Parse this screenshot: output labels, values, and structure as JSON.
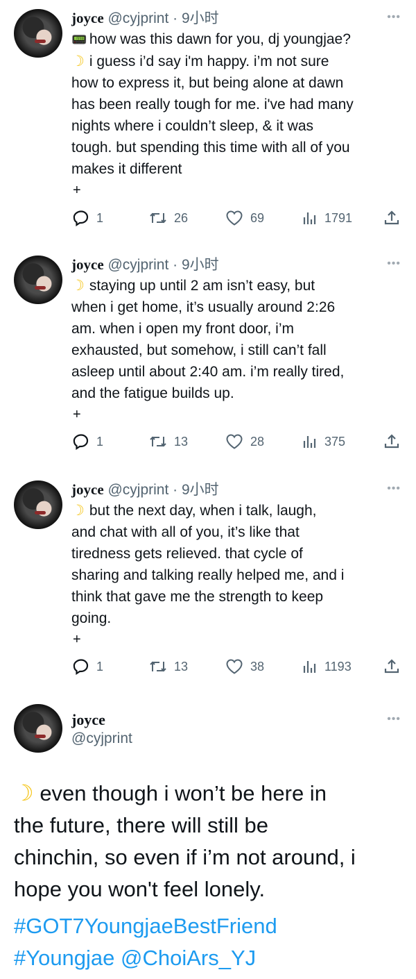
{
  "tweets": [
    {
      "name": "joyce",
      "handle": "@cyjprint",
      "time": " · 9小时",
      "more": "•••",
      "lines": [
        "how was this dawn for you, dj youngjae?",
        "i guess i’d say i'm happy. i’m not sure",
        "how to express it, but being alone at dawn",
        "has been really tough for me. i've had many",
        "nights where i couldn’t sleep, & it was",
        "tough. but spending this time with all of you",
        "makes it different"
      ],
      "plus": "+",
      "reply": "1",
      "retweet": "26",
      "like": "69",
      "views": "1791"
    },
    {
      "name": "joyce",
      "handle": "@cyjprint",
      "time": " · 9小时",
      "more": "•••",
      "lines": [
        "staying up until 2 am isn’t easy, but",
        "when i get home, it’s usually around 2:26",
        "am. when i open my front door, i’m",
        "exhausted, but somehow, i still can’t fall",
        "asleep until about 2:40 am. i’m really tired,",
        "and the fatigue builds up."
      ],
      "plus": "+",
      "reply": "1",
      "retweet": "13",
      "like": "28",
      "views": "375"
    },
    {
      "name": "joyce",
      "handle": "@cyjprint",
      "time": " · 9小时",
      "more": "•••",
      "lines": [
        "but the next day, when i talk, laugh,",
        "and chat with all of you, it’s like that",
        "tiredness gets relieved. that cycle of",
        "sharing and talking really helped me, and i",
        "think that gave me the strength to keep",
        "going."
      ],
      "plus": "+",
      "reply": "1",
      "retweet": "13",
      "like": "38",
      "views": "1193"
    }
  ],
  "main_tweet": {
    "name": "joyce",
    "handle": "@cyjprint",
    "more": "•••",
    "lines": [
      "even though i won’t be here in",
      "the future, there will still be",
      "chinchin, so even if i’m not around, i",
      "hope you won't feel lonely."
    ],
    "hashtag_lines": [
      "#GOT7YoungjaeBestFriend",
      "#Youngjae @ChoiArs_YJ"
    ]
  },
  "colors": {
    "text": "#0f1419",
    "secondary": "#536471",
    "link": "#1d9bf0",
    "moon": "#f5c518"
  },
  "icons": [
    "pager-emoji",
    "crescent-moon-emoji",
    "reply-icon",
    "retweet-icon",
    "like-icon",
    "views-icon",
    "share-icon",
    "more-icon"
  ]
}
